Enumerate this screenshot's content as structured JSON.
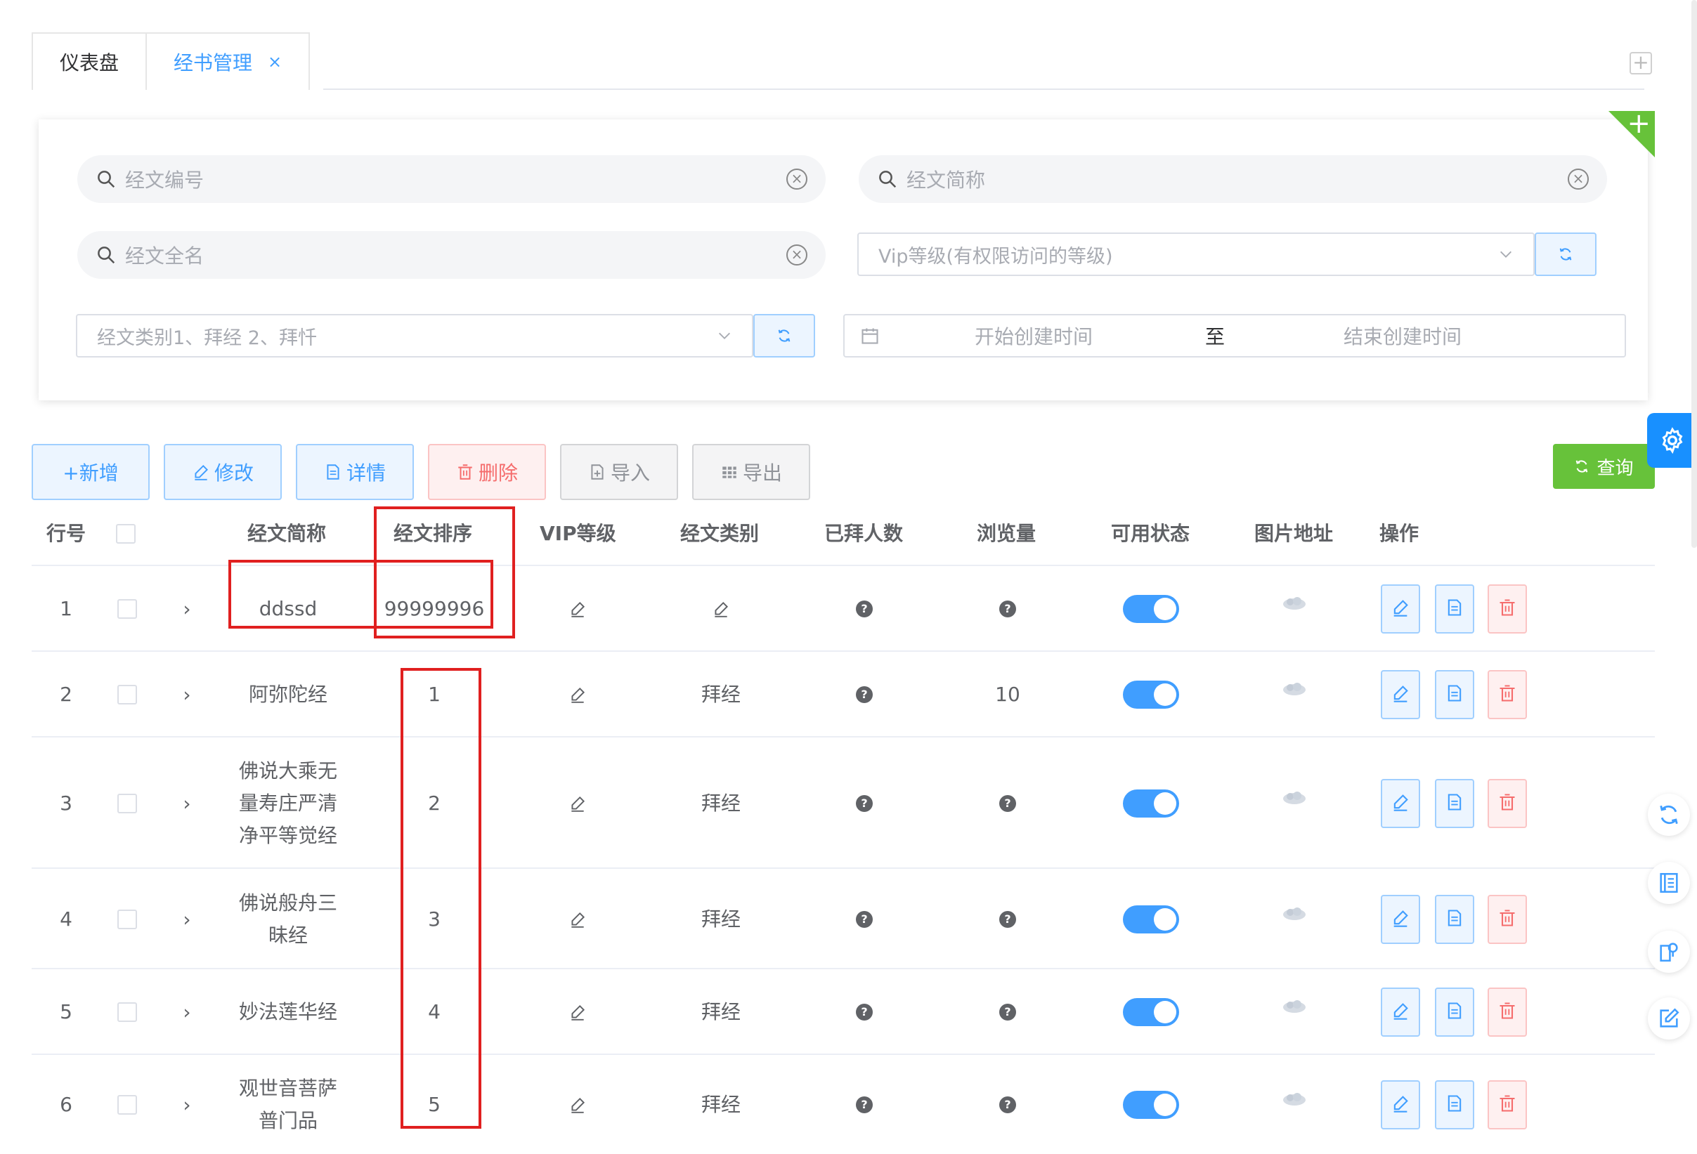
{
  "tabs": [
    {
      "label": "仪表盘",
      "active": false
    },
    {
      "label": "经书管理",
      "active": true,
      "close": "×"
    }
  ],
  "tab_add_label": "+",
  "corner_plus": "+",
  "search": {
    "code_placeholder": "经文编号",
    "short_name_placeholder": "经文简称",
    "full_name_placeholder": "经文全名",
    "vip_placeholder": "Vip等级(有权限访问的等级)",
    "category_placeholder": "经文类别1、拜经 2、拜忏",
    "date_start": "开始创建时间",
    "date_sep": "至",
    "date_end": "结束创建时间"
  },
  "toolbar": {
    "add": "+新增",
    "edit": "修改",
    "detail": "详情",
    "delete": "删除",
    "import": "导入",
    "export": "导出",
    "query": "查询"
  },
  "table": {
    "headers": [
      "行号",
      "经文简称",
      "经文排序",
      "VIP等级",
      "经文类别",
      "已拜人数",
      "浏览量",
      "可用状态",
      "图片地址",
      "操作"
    ],
    "rows": [
      {
        "no": "1",
        "name": [
          "ddssd"
        ],
        "sort": "99999996",
        "category": "",
        "worshipped": "?",
        "views": "?",
        "enabled": true
      },
      {
        "no": "2",
        "name": [
          "阿弥陀经"
        ],
        "sort": "1",
        "category": "拜经",
        "worshipped": "?",
        "views": "10",
        "enabled": true
      },
      {
        "no": "3",
        "name": [
          "佛说大乘无",
          "量寿庄严清",
          "净平等觉经"
        ],
        "sort": "2",
        "category": "拜经",
        "worshipped": "?",
        "views": "?",
        "enabled": true
      },
      {
        "no": "4",
        "name": [
          "佛说般舟三",
          "昧经"
        ],
        "sort": "3",
        "category": "拜经",
        "worshipped": "?",
        "views": "?",
        "enabled": true
      },
      {
        "no": "5",
        "name": [
          "妙法莲华经"
        ],
        "sort": "4",
        "category": "拜经",
        "worshipped": "?",
        "views": "?",
        "enabled": true
      },
      {
        "no": "6",
        "name": [
          "观世音菩萨",
          "普门品"
        ],
        "sort": "5",
        "category": "拜经",
        "worshipped": "?",
        "views": "?",
        "enabled": true
      }
    ],
    "expand_glyph": "›"
  },
  "colors": {
    "primary": "#409eff",
    "success": "#67c23a",
    "danger": "#f56c6c",
    "annotation": "#e02020"
  }
}
